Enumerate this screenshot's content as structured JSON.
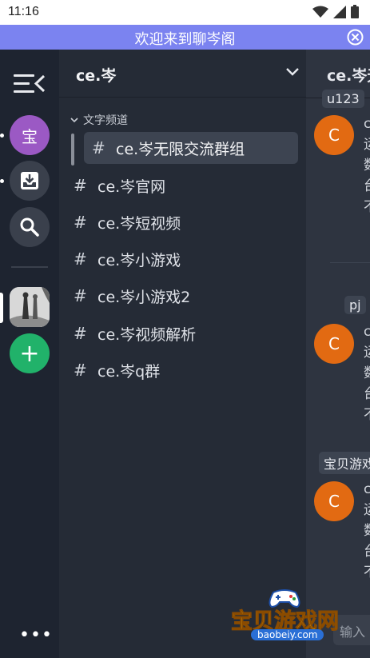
{
  "status_bar": {
    "time": "11:16"
  },
  "banner": {
    "text": "欢迎来到聊岑阁"
  },
  "server_rail": {
    "server_initial": "宝",
    "add_label": "+",
    "more_label": "•••"
  },
  "channel_panel": {
    "server_name": "ce.岑",
    "category": "文字频道",
    "hash": "#",
    "channels": [
      {
        "label": "ce.岑无限交流群组"
      },
      {
        "label": "ce.岑官网"
      },
      {
        "label": "ce.岑短视频"
      },
      {
        "label": "ce.岑小游戏"
      },
      {
        "label": "ce.岑小游戏2"
      },
      {
        "label": "ce.岑视频解析"
      },
      {
        "label": "ce.岑q群"
      }
    ]
  },
  "chat": {
    "title": "ce.岑无",
    "pills": [
      "u123",
      "pj",
      "宝贝游戏"
    ],
    "avatar_letter": "C",
    "messages": [
      {
        "lines": [
          "c",
          "运",
          "数",
          "台",
          "不"
        ]
      },
      {
        "lines": [
          "c",
          "运",
          "数",
          "台",
          "不"
        ]
      },
      {
        "lines": [
          "c",
          "运",
          "数",
          "台",
          "不"
        ]
      }
    ],
    "input_placeholder": "输入"
  },
  "watermark": {
    "text": "宝贝游戏网",
    "url": "baobeiy.com"
  },
  "colors": {
    "banner": "#7b83f0",
    "rail": "#1e2430",
    "channel_panel": "#252b36",
    "avatar": "#e26a12",
    "add_server": "#21b26a",
    "server_bao": "#9b59c4"
  }
}
